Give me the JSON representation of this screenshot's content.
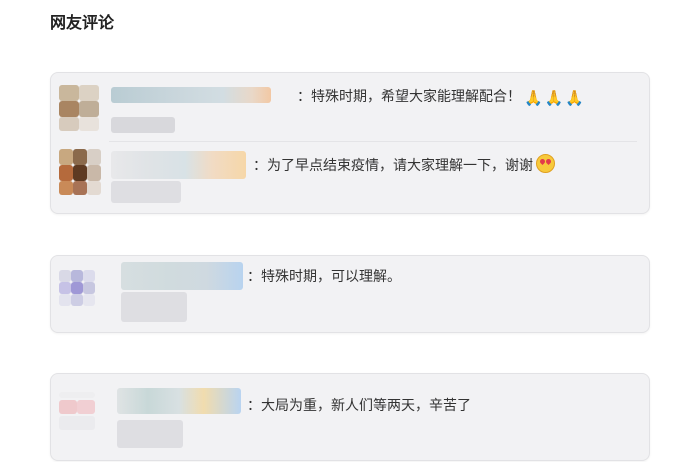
{
  "section": {
    "title": "网友评论"
  },
  "comments": [
    {
      "text": "：特殊时期，希望大家能理解配合！",
      "emoji": "🙏🙏🙏",
      "emoji_icon": "pray-icon"
    },
    {
      "text": "：为了早点结束疫情，请大家理解一下，谢谢",
      "emoji_icon": "heart-eyes-face-icon"
    },
    {
      "text": "：特殊时期，可以理解。"
    },
    {
      "text": "：大局为重，新人们等两天，辛苦了"
    }
  ]
}
